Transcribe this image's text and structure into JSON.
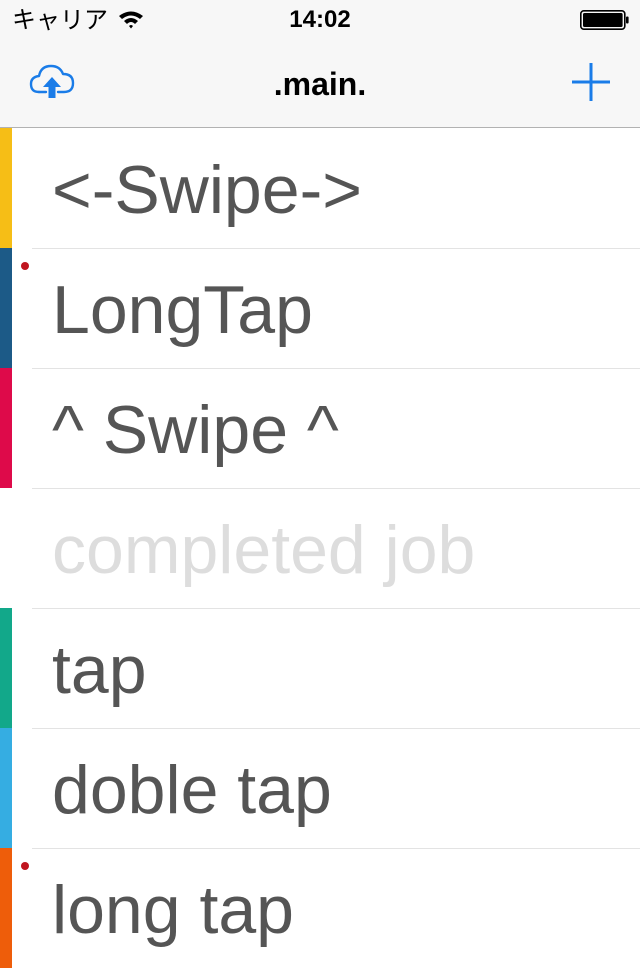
{
  "status_bar": {
    "carrier": "キャリア",
    "time": "14:02"
  },
  "nav": {
    "title": ".main.",
    "left_icon": "cloud-upload-icon",
    "right_icon": "plus-icon",
    "accent_color": "#1a7ce8"
  },
  "list": {
    "items": [
      {
        "label": "<-Swipe->",
        "color": "#f6be16",
        "dot": false,
        "completed": false
      },
      {
        "label": "LongTap",
        "color": "#1c5a87",
        "dot": true,
        "completed": false
      },
      {
        "label": "^ Swipe ^",
        "color": "#de0a4a",
        "dot": false,
        "completed": false
      },
      {
        "label": "completed job",
        "color": "",
        "dot": false,
        "completed": true
      },
      {
        "label": "tap",
        "color": "#12a88a",
        "dot": false,
        "completed": false
      },
      {
        "label": "doble tap",
        "color": "#35ade2",
        "dot": false,
        "completed": false
      },
      {
        "label": "long tap",
        "color": "#ee5d0a",
        "dot": true,
        "completed": false
      }
    ],
    "dot_color": "#c0151f",
    "text_color": "#555555",
    "completed_text_color": "#dddddd"
  }
}
